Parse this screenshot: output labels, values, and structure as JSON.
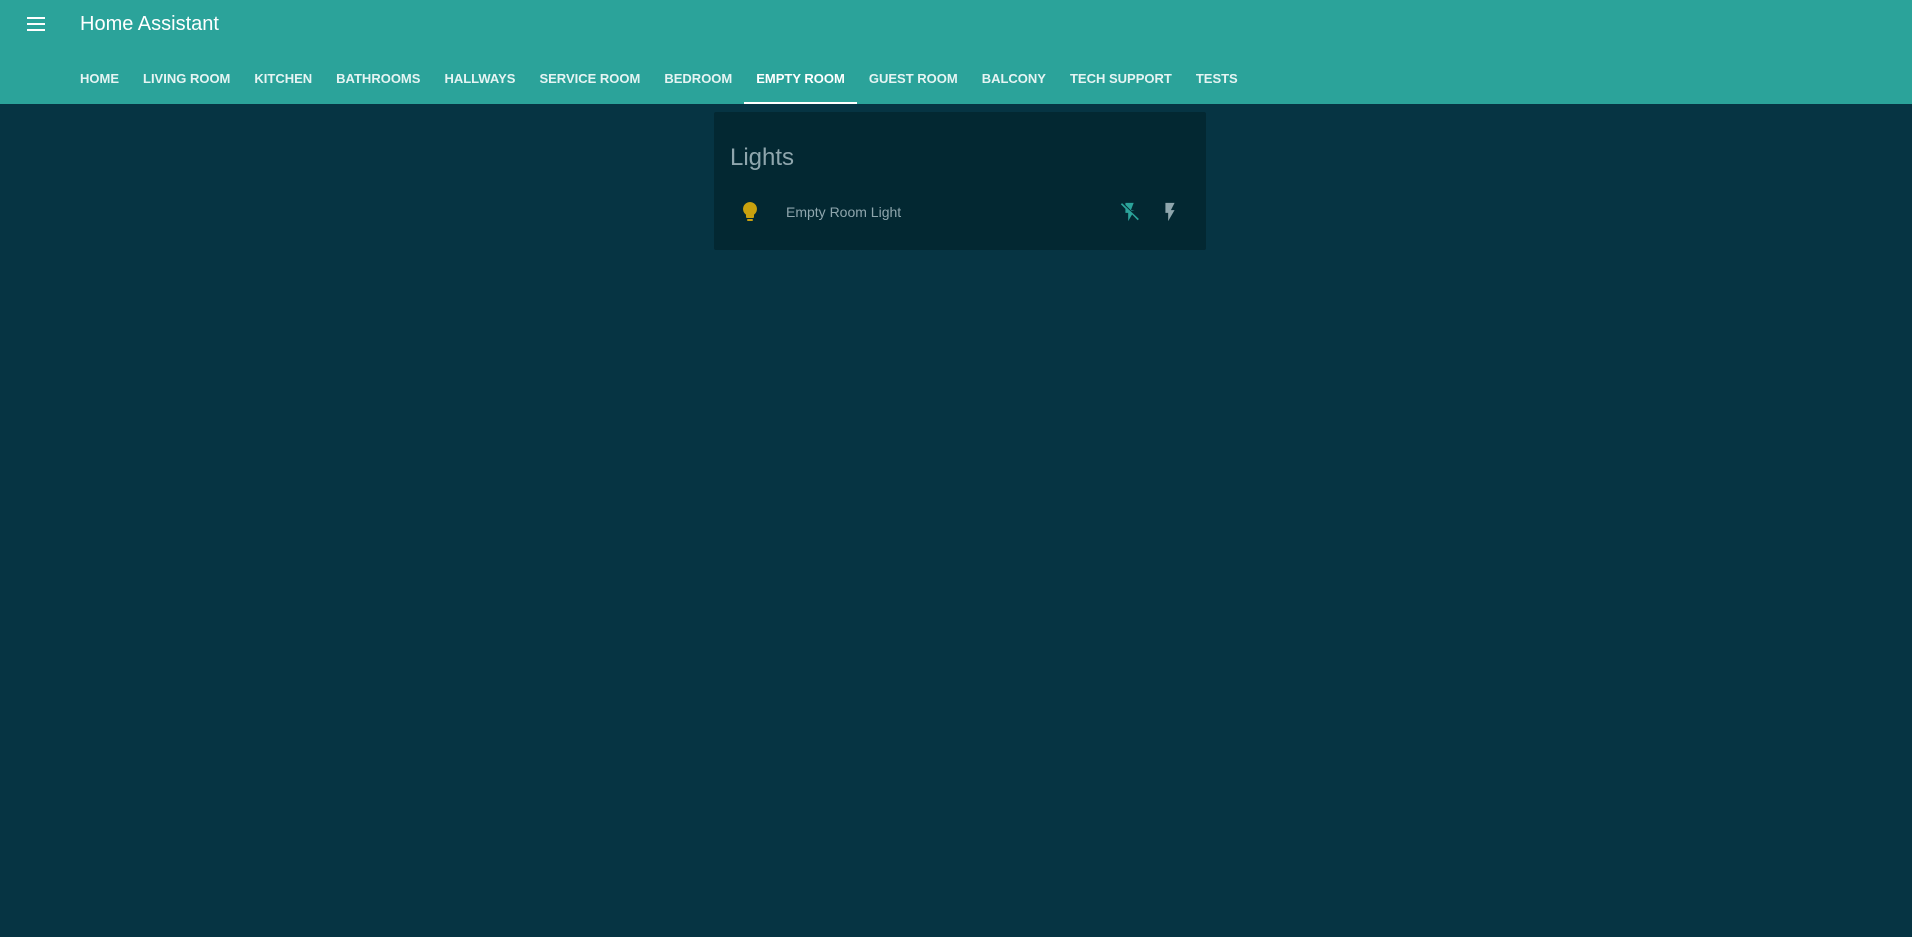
{
  "header": {
    "title": "Home Assistant",
    "menu_icon": "menu-icon",
    "background_color": "#2ba39a"
  },
  "tabs": [
    {
      "label": "HOME",
      "active": false
    },
    {
      "label": "LIVING ROOM",
      "active": false
    },
    {
      "label": "KITCHEN",
      "active": false
    },
    {
      "label": "BATHROOMS",
      "active": false
    },
    {
      "label": "HALLWAYS",
      "active": false
    },
    {
      "label": "SERVICE ROOM",
      "active": false
    },
    {
      "label": "BEDROOM",
      "active": false
    },
    {
      "label": "EMPTY ROOM",
      "active": true
    },
    {
      "label": "GUEST ROOM",
      "active": false
    },
    {
      "label": "BALCONY",
      "active": false
    },
    {
      "label": "TECH SUPPORT",
      "active": false
    },
    {
      "label": "TESTS",
      "active": false
    }
  ],
  "card": {
    "title": "Lights",
    "entities": [
      {
        "name": "Empty Room Light",
        "icon": "lightbulb-icon",
        "icon_color": "#c9a10e",
        "actions": [
          {
            "name": "flash-off-icon",
            "color": "#2ba39a"
          },
          {
            "name": "flash-icon",
            "color": "#8fa6ad"
          }
        ]
      }
    ]
  },
  "theme": {
    "page_background": "#063443",
    "card_background": "#032832",
    "secondary_text": "#8fa6ad"
  }
}
